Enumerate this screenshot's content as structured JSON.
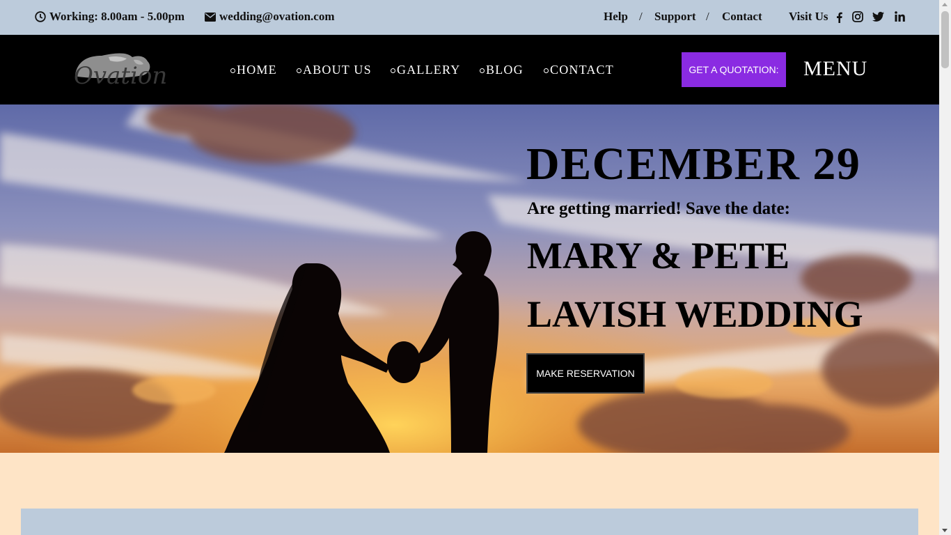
{
  "topbar": {
    "hours_icon": "clock-icon",
    "hours": "Working: 8.00am - 5.00pm",
    "email_icon": "envelope-icon",
    "email": "wedding@ovation.com",
    "links": [
      "Help",
      "Support",
      "Contact"
    ],
    "separator": "/",
    "visit_us": "Visit Us",
    "social_icons": [
      "facebook-icon",
      "instagram-icon",
      "twitter-icon",
      "linkedin-icon"
    ]
  },
  "navbar": {
    "logo_text": "Ovation",
    "items": [
      "HOME",
      "ABOUT US",
      "GALLERY",
      "BLOG",
      "CONTACT"
    ],
    "quote_button": "GET A QUOTATION:",
    "menu_button": "MENU"
  },
  "hero": {
    "date": "DECEMBER 29",
    "subtitle": "Are getting married! Save the date:",
    "names": "MARY & PETE",
    "tagline": "LAVISH WEDDING",
    "cta": "MAKE RESERVATION"
  },
  "colors": {
    "topbar_bg": "#bccbdb",
    "navbar_bg": "#000000",
    "accent": "#8a2be2",
    "page_bg": "#fee4c6"
  }
}
